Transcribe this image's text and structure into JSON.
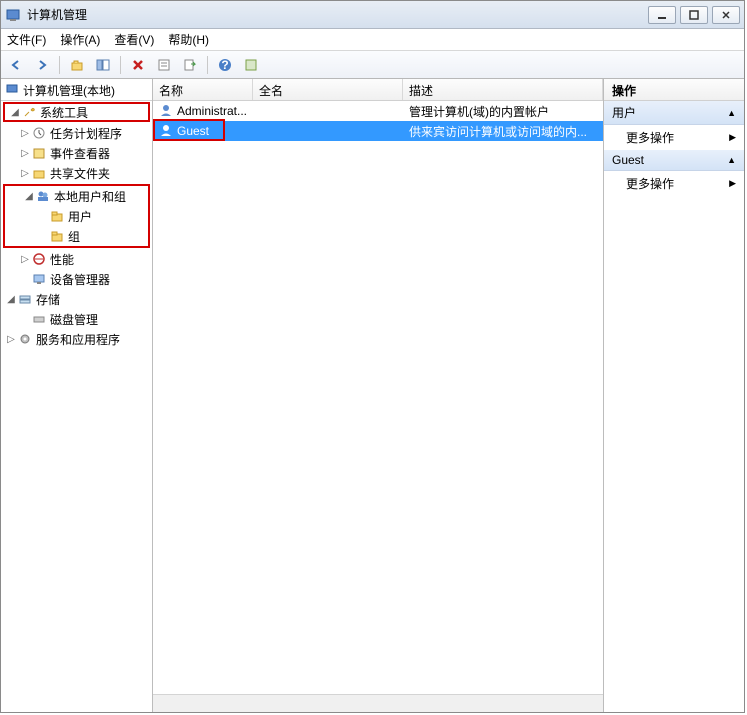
{
  "window": {
    "title": "计算机管理"
  },
  "menu": {
    "file": "文件(F)",
    "action": "操作(A)",
    "view": "查看(V)",
    "help": "帮助(H)"
  },
  "tree": {
    "root": "计算机管理(本地)",
    "system_tools": "系统工具",
    "task_scheduler": "任务计划程序",
    "event_viewer": "事件查看器",
    "shared_folders": "共享文件夹",
    "local_users_groups": "本地用户和组",
    "users": "用户",
    "groups": "组",
    "performance": "性能",
    "device_manager": "设备管理器",
    "storage": "存储",
    "disk_management": "磁盘管理",
    "services_apps": "服务和应用程序"
  },
  "list": {
    "headers": {
      "name": "名称",
      "fullname": "全名",
      "description": "描述"
    },
    "rows": [
      {
        "name": "Administrat...",
        "fullname": "",
        "description": "管理计算机(域)的内置帐户"
      },
      {
        "name": "Guest",
        "fullname": "",
        "description": "供来宾访问计算机或访问域的内..."
      }
    ]
  },
  "actions": {
    "header": "操作",
    "group1": "用户",
    "more1": "更多操作",
    "group2": "Guest",
    "more2": "更多操作"
  }
}
